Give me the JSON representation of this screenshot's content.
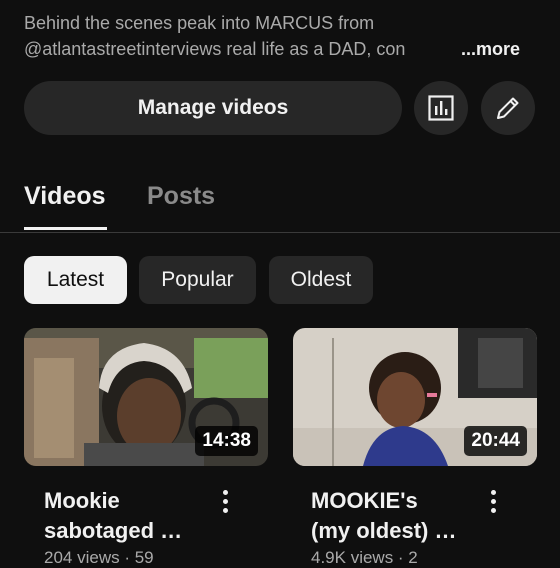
{
  "channel_description": {
    "line1": "Behind the scenes peak into MARCUS from",
    "line2": "@atlantastreetinterviews real life as a DAD, con",
    "more_label": "...more"
  },
  "actions": {
    "manage_videos_label": "Manage videos",
    "analytics_icon": "bar-chart-icon",
    "edit_icon": "pencil-icon"
  },
  "tabs": [
    {
      "label": "Videos",
      "active": true
    },
    {
      "label": "Posts",
      "active": false
    }
  ],
  "filters": [
    {
      "label": "Latest",
      "selected": true
    },
    {
      "label": "Popular",
      "selected": false
    },
    {
      "label": "Oldest",
      "selected": false
    }
  ],
  "videos": [
    {
      "title_line1": "Mookie",
      "title_line2": "sabotaged …",
      "duration": "14:38",
      "meta": "204 views · 59"
    },
    {
      "title_line1": "MOOKIE's",
      "title_line2": "(my oldest) …",
      "duration": "20:44",
      "meta": "4.9K views · 2"
    }
  ],
  "colors": {
    "background": "#0f0f0f",
    "surface": "#272727",
    "text": "#f1f1f1",
    "muted": "#aaaaaa"
  }
}
